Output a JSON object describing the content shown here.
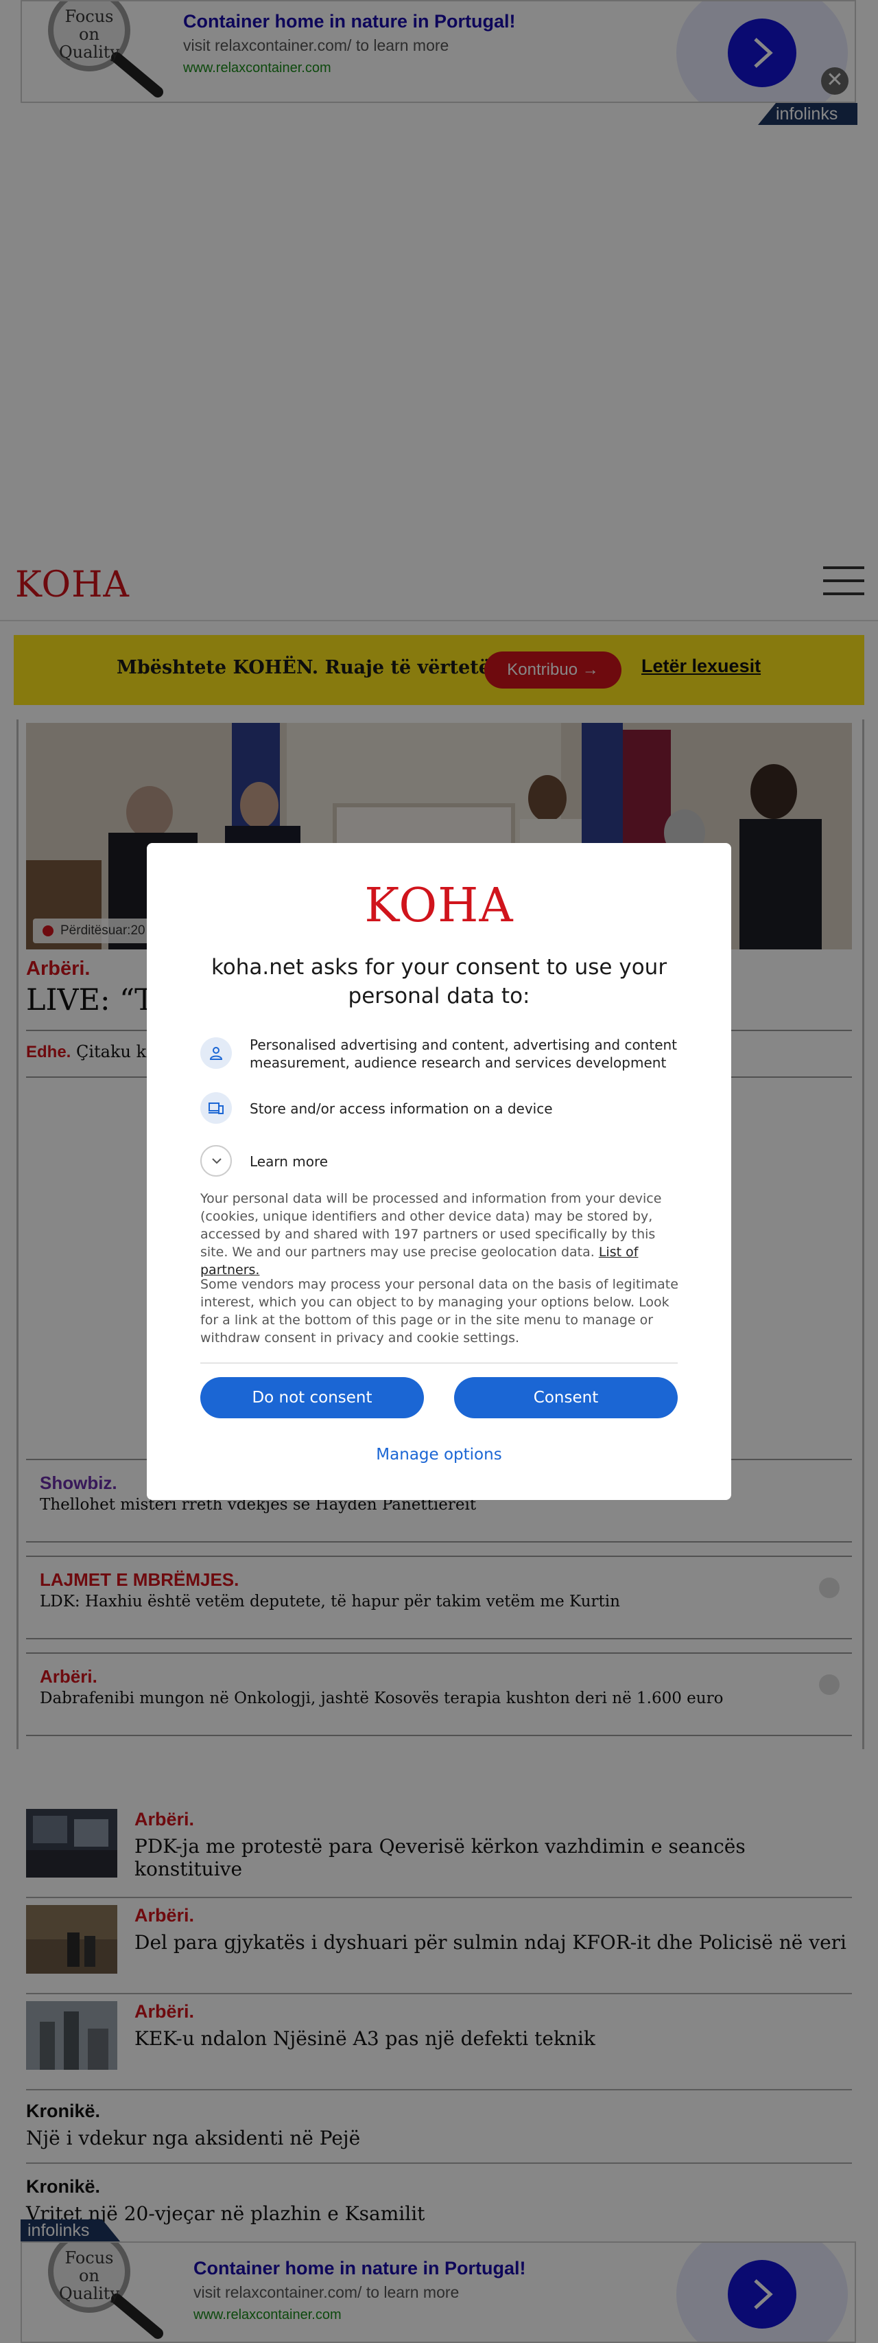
{
  "ad": {
    "logo_line1": "Focus",
    "logo_line2": "on",
    "logo_line3": "Quality",
    "headline": "Container home in nature in Portugal!",
    "description": "visit relaxcontainer.com/ to learn more",
    "url": "www.relaxcontainer.com",
    "network": "infolinks",
    "close_glyph": "✕"
  },
  "header": {
    "logo": "KOHA"
  },
  "banner": {
    "text": "Mbështete KOHËN. Ruaje të vërtetën",
    "button_label": "Kontribuo →",
    "link_label": "Letër lexuesit"
  },
  "hero": {
    "badge": "Përditësuar:20",
    "kicker": "Arbëri.",
    "title": "LIVE: “Ta",
    "also_label": "Edhe.",
    "also_text": "Çitaku ko"
  },
  "related": [
    {
      "kicker": "Showbiz.",
      "title": "Thellohet misteri rreth vdekjes së Hayden Panettiereit",
      "color": "#6b2fa8"
    },
    {
      "kicker": "LAJMET E MBRËMJES.",
      "title": "LDK: Haxhiu është vetëm deputete, të hapur për takim vetëm me Kurtin",
      "color": "#d0141c"
    },
    {
      "kicker": "Arbëri.",
      "title": "Dabrafenibi mungon në Onkologji, jashtë Kosovës terapia kushton deri në 1.600 euro",
      "color": "#d0141c"
    }
  ],
  "articles": [
    {
      "kicker": "Arbëri.",
      "title": "PDK-ja me protestë para Qeverisë kërkon vazhdimin e seancës konstituive"
    },
    {
      "kicker": "Arbëri.",
      "title": "Del para gjykatës i dyshuari për sulmin ndaj KFOR-it dhe Policisë në veri"
    },
    {
      "kicker": "Arbëri.",
      "title": "KEK-u ndalon Njësinë A3 pas një defekti teknik"
    }
  ],
  "text_articles": [
    {
      "kicker": "Kronikë.",
      "title": "Një i vdekur nga aksidenti në Pejë"
    },
    {
      "kicker": "Kronikë.",
      "title": "Vritet një 20-vjeçar në plazhin e Ksamilit"
    }
  ],
  "consent": {
    "logo": "KOHA",
    "title": "koha.net asks for your consent to use your personal data to:",
    "purposes": [
      {
        "icon": "person-icon",
        "text": "Personalised advertising and content, advertising and content measurement, audience research and services development"
      },
      {
        "icon": "devices-icon",
        "text": "Store and/or access information on a device"
      }
    ],
    "learn_more": "Learn more",
    "paragraph1": "Your personal data will be processed and information from your device (cookies, unique identifiers and other device data) may be stored by, accessed by and shared with 197 partners or used specifically by this site. We and our partners may use precise geolocation data.",
    "partners_link": "List of partners.",
    "paragraph2": "Some vendors may process your personal data on the basis of legitimate interest, which you can object to by managing your options below. Look for a link at the bottom of this page or in the site menu to manage or withdraw consent in privacy and cookie settings.",
    "do_not_consent": "Do not consent",
    "consent": "Consent",
    "manage_options": "Manage options"
  },
  "colors": {
    "brand_red": "#d0141c",
    "consent_blue": "#1b66d4",
    "banner_yellow": "#ffe61b",
    "ad_blue": "#1414d6"
  }
}
